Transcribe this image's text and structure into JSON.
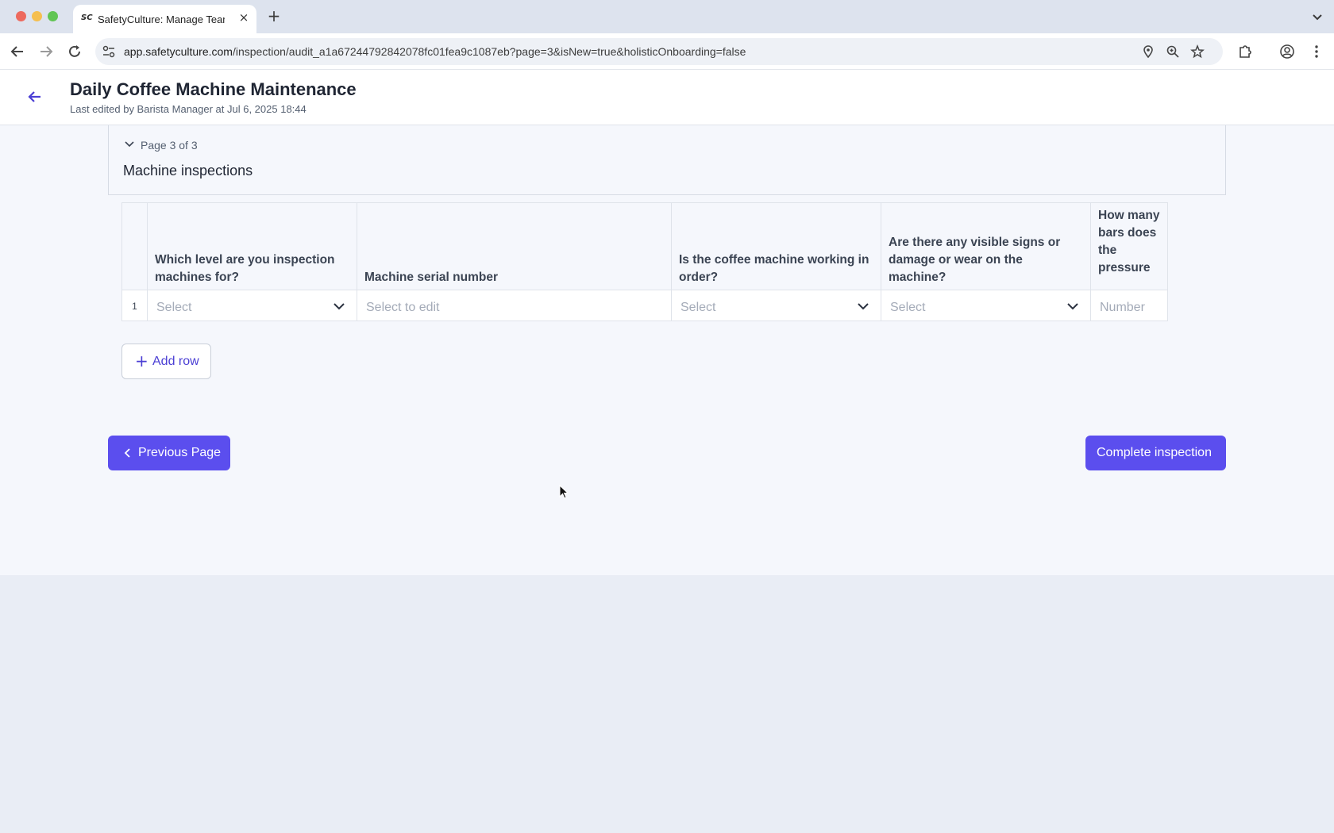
{
  "browser": {
    "tab_title": "SafetyCulture: Manage Teams",
    "tab_favicon": "SC",
    "tab_close": "×",
    "new_tab": "+",
    "url_host": "app.safetyculture.com",
    "url_path": "/inspection/audit_a1a67244792842078fc01fea9c1087eb?page=3&isNew=true&holisticOnboarding=false",
    "icons": [
      "back-icon",
      "forward-icon",
      "reload-icon",
      "site-settings-icon",
      "location-icon",
      "zoom-icon",
      "bookmark-star-icon",
      "extensions-icon",
      "profile-icon",
      "menu-dots-icon",
      "tab-list-icon"
    ]
  },
  "header": {
    "title": "Daily Coffee Machine Maintenance",
    "subtitle": "Last edited by Barista Manager at Jul 6, 2025 18:44"
  },
  "page": {
    "indicator": "Page 3 of 3",
    "section_title": "Machine inspections"
  },
  "table": {
    "columns": [
      {
        "header": "",
        "cell": "1"
      },
      {
        "header": "Which level are you inspection machines for?",
        "cell": "Select"
      },
      {
        "header": "Machine serial number",
        "cell": "Select to edit"
      },
      {
        "header": "Is the coffee machine working in order?",
        "cell": "Select"
      },
      {
        "header": "Are there any visible signs or damage or wear on the machine?",
        "cell": "Select"
      },
      {
        "header": "How many bars does the pressure",
        "cell": "Number"
      }
    ],
    "add_row_label": "Add row"
  },
  "footer": {
    "previous_label": "Previous Page",
    "complete_label": "Complete inspection"
  },
  "colors": {
    "primary": "#5b4eee",
    "link": "#4b3fd4",
    "background": "#f5f7fc"
  }
}
